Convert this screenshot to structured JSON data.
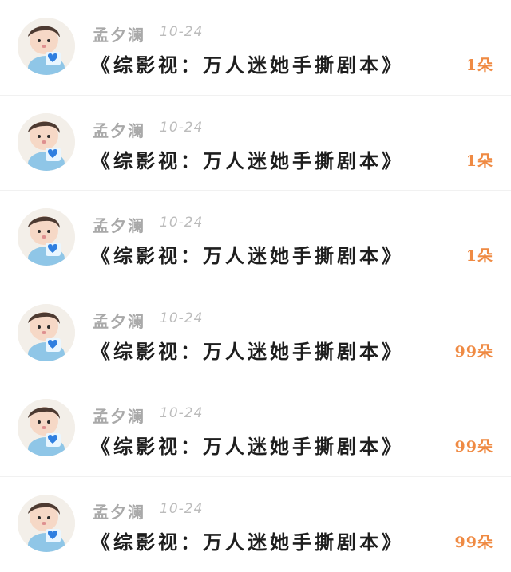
{
  "items": [
    {
      "username": "孟夕澜",
      "date": "10-24",
      "title": "《综影视：万人迷她手撕剧本》",
      "count": "1朵"
    },
    {
      "username": "孟夕澜",
      "date": "10-24",
      "title": "《综影视：万人迷她手撕剧本》",
      "count": "1朵"
    },
    {
      "username": "孟夕澜",
      "date": "10-24",
      "title": "《综影视：万人迷她手撕剧本》",
      "count": "1朵"
    },
    {
      "username": "孟夕澜",
      "date": "10-24",
      "title": "《综影视：万人迷她手撕剧本》",
      "count": "99朵"
    },
    {
      "username": "孟夕澜",
      "date": "10-24",
      "title": "《综影视：万人迷她手撕剧本》",
      "count": "99朵"
    },
    {
      "username": "孟夕澜",
      "date": "10-24",
      "title": "《综影视：万人迷她手撕剧本》",
      "count": "99朵"
    }
  ],
  "colors": {
    "accent": "#ef8a43",
    "name": "#a9a9a9",
    "date": "#bcbcbc",
    "title": "#1e1e1e"
  },
  "icons": {
    "avatar": "child-with-blue-heart-avatar"
  }
}
